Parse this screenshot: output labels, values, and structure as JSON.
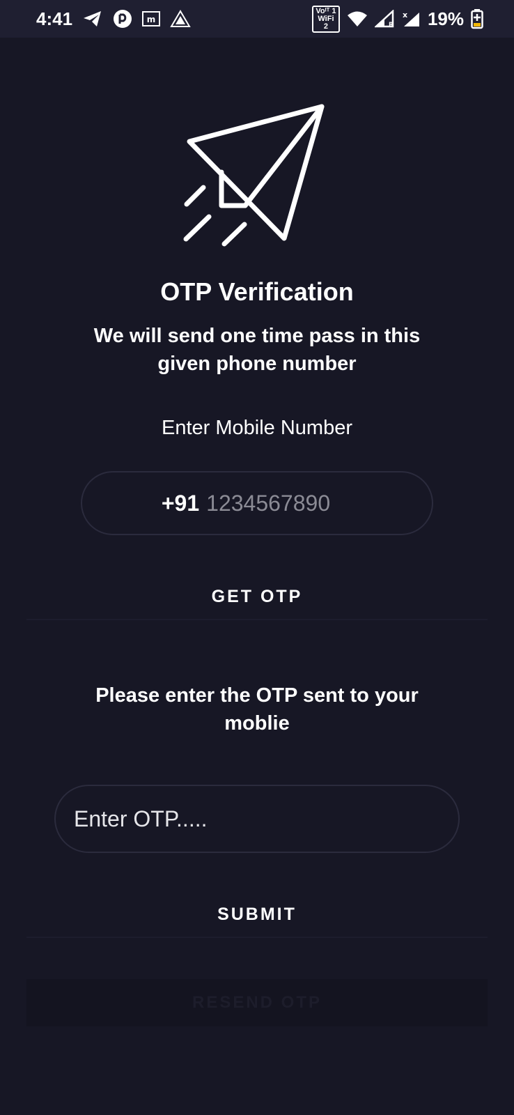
{
  "status_bar": {
    "time": "4:41",
    "volte_line1": "Voᴵᵀ 1",
    "volte_line2": "WiFi 2",
    "battery_percent": "19%",
    "icons": [
      "telegram-icon",
      "app-notification-icon",
      "m-notification-icon",
      "triangle-app-icon",
      "volte-wifi-icon",
      "wifi-icon",
      "signal-icon",
      "signal-no-service-icon",
      "battery-charging-icon"
    ]
  },
  "hero": {
    "icon": "paper-plane-icon"
  },
  "header": {
    "title": "OTP Verification",
    "subtitle": "We will send one time pass in this given phone number"
  },
  "mobile": {
    "label": "Enter Mobile Number",
    "country_code": "+91",
    "placeholder": "1234567890",
    "value": ""
  },
  "get_otp_label": "GET OTP",
  "otp": {
    "prompt": "Please enter the OTP sent to your moblie",
    "placeholder": "Enter OTP.....",
    "value": ""
  },
  "submit_label": "SUBMIT",
  "resend_label": "RESEND OTP",
  "colors": {
    "background": "#171725",
    "status_bar": "#1f1f31",
    "field_border": "#2b2b3d",
    "placeholder": "#8b8b95",
    "disabled_button": "#141420"
  }
}
